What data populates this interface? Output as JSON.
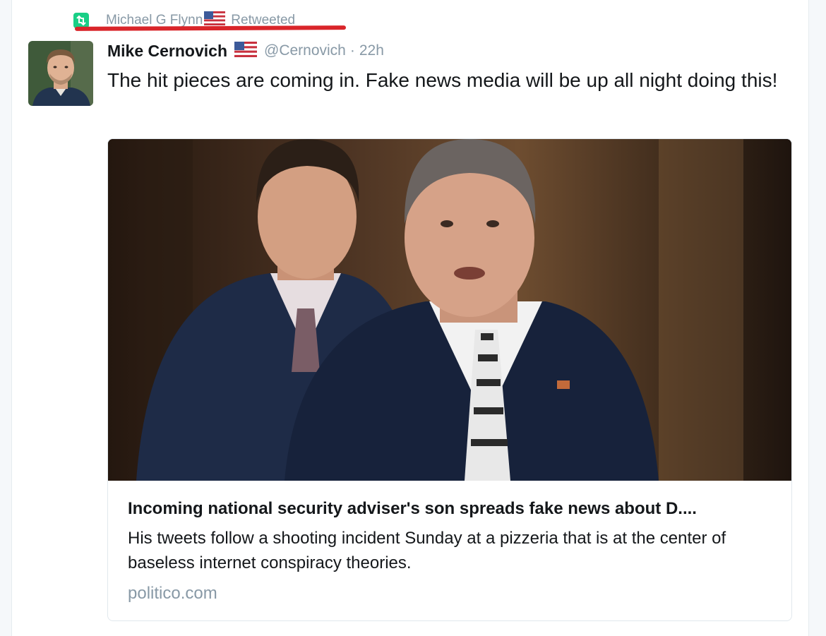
{
  "retweet_context": {
    "name": "Michael G Flynn",
    "action": "Retweeted",
    "flag_icon": "us-flag-icon",
    "icon": "retweet-icon",
    "icon_color": "#19cf86",
    "underline_color": "#d9252a"
  },
  "tweet": {
    "author_name": "Mike Cernovich",
    "handle": "@Cernovich",
    "separator": "·",
    "time": "22h",
    "text": "The hit pieces are coming in. Fake news media will be up all night doing this!"
  },
  "card": {
    "title": "Incoming national security adviser's son spreads fake news about D....",
    "description": "His tweets follow a shooting incident Sunday at a pizzeria that is at the center of baseless internet conspiracy theories.",
    "domain": "politico.com"
  }
}
